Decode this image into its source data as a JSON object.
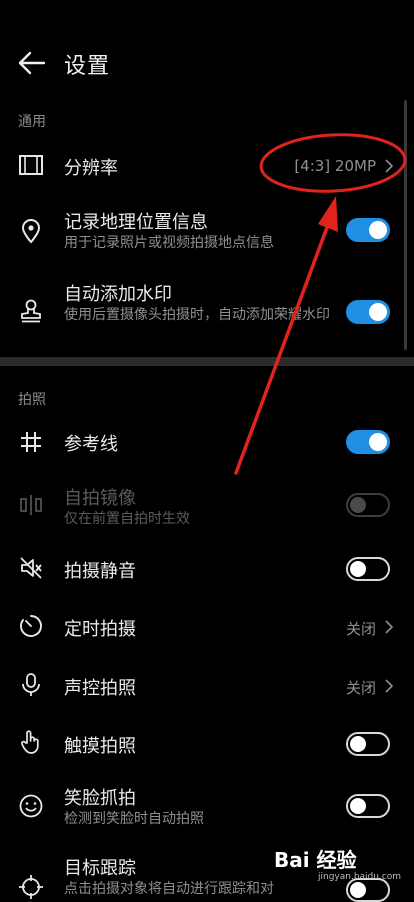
{
  "header": {
    "title": "设置"
  },
  "sections": {
    "general": "通用",
    "photo": "拍照"
  },
  "rows": {
    "resolution": {
      "title": "分辨率",
      "value": "[4:3] 20MP"
    },
    "location": {
      "title": "记录地理位置信息",
      "sub": "用于记录照片或视频拍摄地点信息",
      "state": "on"
    },
    "watermark": {
      "title": "自动添加水印",
      "sub": "使用后置摄像头拍摄时，自动添加荣耀水印",
      "state": "on"
    },
    "gridlines": {
      "title": "参考线",
      "state": "on"
    },
    "mirror": {
      "title": "自拍镜像",
      "sub": "仅在前置自拍时生效",
      "state": "disabled"
    },
    "mute": {
      "title": "拍摄静音",
      "state": "off"
    },
    "timer": {
      "title": "定时拍摄",
      "value": "关闭"
    },
    "voice": {
      "title": "声控拍照",
      "value": "关闭"
    },
    "touch": {
      "title": "触摸拍照",
      "state": "off"
    },
    "smile": {
      "title": "笑脸抓拍",
      "sub": "检测到笑脸时自动拍照",
      "state": "off"
    },
    "tracking": {
      "title": "目标跟踪",
      "sub": "点击拍摄对象将自动进行跟踪和对",
      "state": "off"
    }
  },
  "watermark_overlay": {
    "brand": "Bai 经验",
    "url": "jingyan.baidu.com"
  },
  "colors": {
    "accent": "#1e8fe3",
    "annotation": "#e0241b",
    "background": "#000000"
  }
}
